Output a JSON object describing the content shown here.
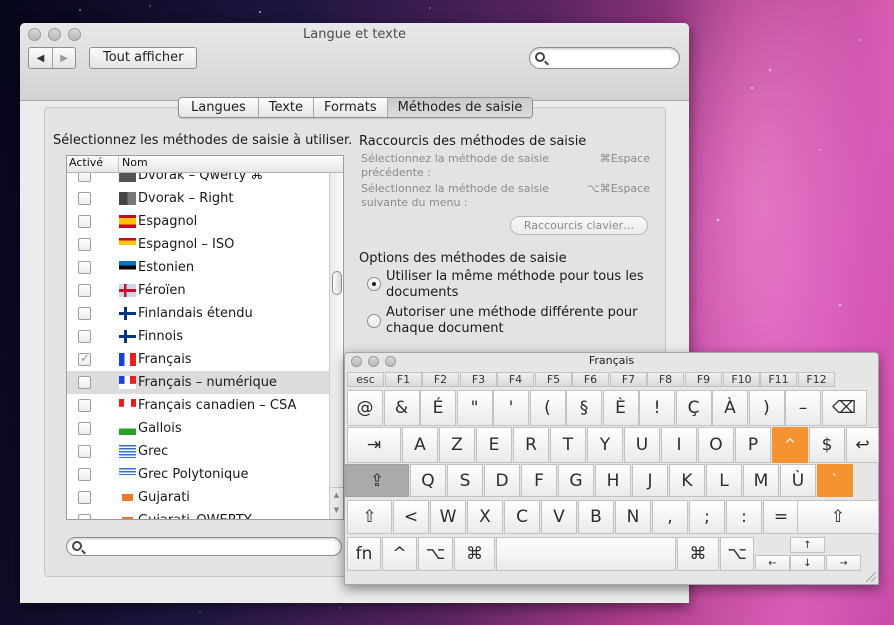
{
  "window": {
    "title": "Langue et texte",
    "back_icon": "◀",
    "forward_icon": "▶",
    "show_all_label": "Tout afficher",
    "search_placeholder": ""
  },
  "tabs": [
    {
      "label": "Langues",
      "active": false
    },
    {
      "label": "Texte",
      "active": false
    },
    {
      "label": "Formats",
      "active": false
    },
    {
      "label": "Méthodes de saisie",
      "active": true
    }
  ],
  "input_methods": {
    "heading": "Sélectionnez les méthodes de saisie à utiliser.",
    "columns": [
      "Activé",
      "Nom"
    ],
    "rows": [
      {
        "name": "Dvorak – Qwerty ⌘",
        "enabled": false,
        "flag": "dvorak-qwerty"
      },
      {
        "name": "Dvorak – Right",
        "enabled": false,
        "flag": "dvorak"
      },
      {
        "name": "Espagnol",
        "enabled": false,
        "flag": "es"
      },
      {
        "name": "Espagnol – ISO",
        "enabled": false,
        "flag": "es-iso"
      },
      {
        "name": "Estonien",
        "enabled": false,
        "flag": "ee"
      },
      {
        "name": "Féroïen",
        "enabled": false,
        "flag": "fo"
      },
      {
        "name": "Finlandais étendu",
        "enabled": false,
        "flag": "fi-ext"
      },
      {
        "name": "Finnois",
        "enabled": false,
        "flag": "fi"
      },
      {
        "name": "Français",
        "enabled": true,
        "flag": "fr"
      },
      {
        "name": "Français – numérique",
        "enabled": false,
        "flag": "fr-123",
        "selected": true
      },
      {
        "name": "Français canadien – CSA",
        "enabled": false,
        "flag": "ca-csa"
      },
      {
        "name": "Gallois",
        "enabled": false,
        "flag": "wales"
      },
      {
        "name": "Grec",
        "enabled": false,
        "flag": "gr"
      },
      {
        "name": "Grec Polytonique",
        "enabled": false,
        "flag": "gr-poly"
      },
      {
        "name": "Gujarati",
        "enabled": false,
        "flag": "gujarati"
      },
      {
        "name": "Gujarati–QWERTY",
        "enabled": false,
        "flag": "gujarati"
      }
    ],
    "filter_placeholder": ""
  },
  "shortcuts": {
    "heading": "Raccourcis des méthodes de saisie",
    "items": [
      {
        "label": "Sélectionnez la méthode de saisie précédente :",
        "keys": "⌘Espace"
      },
      {
        "label": "Sélectionnez la méthode de saisie suivante du menu :",
        "keys": "⌥⌘Espace"
      }
    ],
    "button_label": "Raccourcis clavier…"
  },
  "options": {
    "heading": "Options des méthodes de saisie",
    "choices": [
      {
        "label": "Utiliser la même méthode pour tous les documents",
        "selected": true
      },
      {
        "label": "Autoriser une méthode différente pour chaque document",
        "selected": false
      }
    ]
  },
  "keyboard_viewer": {
    "title": "Français",
    "function_row": [
      "esc",
      "F1",
      "F2",
      "F3",
      "F4",
      "F5",
      "F6",
      "F7",
      "F8",
      "F9",
      "F10",
      "F11",
      "F12"
    ],
    "row1": [
      "@",
      "&",
      "É",
      "\"",
      "'",
      "(",
      "§",
      "È",
      "!",
      "Ç",
      "À",
      ")",
      "–",
      "⌫"
    ],
    "row2": [
      "⇥",
      "A",
      "Z",
      "E",
      "R",
      "T",
      "Y",
      "U",
      "I",
      "O",
      "P",
      "^",
      "$",
      "↩"
    ],
    "row3": [
      "⇪",
      "Q",
      "S",
      "D",
      "F",
      "G",
      "H",
      "J",
      "K",
      "L",
      "M",
      "Ù",
      "`"
    ],
    "row4": [
      "⇧",
      "<",
      "W",
      "X",
      "C",
      "V",
      "B",
      "N",
      ",",
      ";",
      ":",
      "=",
      "⇧"
    ],
    "row5": [
      "fn",
      "^",
      "⌥",
      "⌘",
      "",
      "⌘",
      "⌥"
    ],
    "arrows": {
      "up": "↑",
      "left": "←",
      "down": "↓",
      "right": "→"
    },
    "highlighted_keys": [
      "^",
      "`"
    ],
    "pressed_keys": [
      "⇪"
    ],
    "highlight_color": "#f39430"
  }
}
